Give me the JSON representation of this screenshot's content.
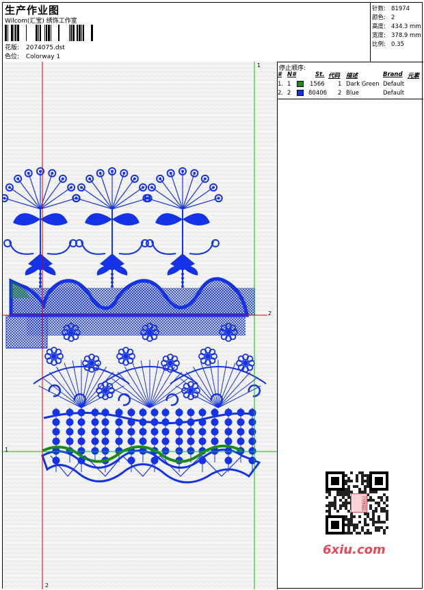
{
  "header": {
    "title": "生产作业图",
    "company": "Wilcom(汇宝) 绣饰工作室",
    "design_label": "花版:",
    "design_value": "2074075.dst",
    "colorway_label": "色位:",
    "colorway_value": "Colorway 1"
  },
  "stats": [
    {
      "label": "针数:",
      "value": "81974"
    },
    {
      "label": "颜色:",
      "value": "2"
    },
    {
      "label": "高度:",
      "value": "434.3 mm"
    },
    {
      "label": "宽度:",
      "value": "378.9 mm"
    },
    {
      "label": "比例:",
      "value": "0.35"
    }
  ],
  "stop_sequence": {
    "title": "停止顺序:",
    "columns": [
      "#",
      "N#",
      "St.",
      "代码",
      "描述",
      "Brand",
      "元素"
    ],
    "rows": [
      {
        "index": "1.",
        "needle": "1",
        "stitches": "1566",
        "code": "1",
        "description": "Dark Green",
        "brand": "Default",
        "color": "#1a8a1a"
      },
      {
        "index": "2.",
        "needle": "2",
        "stitches": "80406",
        "code": "2",
        "description": "Blue",
        "brand": "Default",
        "color": "#1432e6"
      }
    ]
  },
  "guides": {
    "vertical_left": "2",
    "vertical_right": "1",
    "horizontal_top": "2",
    "horizontal_bottom": "1",
    "bottom_label": "2"
  },
  "watermark": {
    "text": "6xiu.com",
    "stamp": "汉语图"
  },
  "colors": {
    "thread_blue": "#1432e6",
    "thread_green": "#1a8a1a",
    "guide_red": "#e00000",
    "guide_green": "#00c000",
    "canvas_bg": "#f3f3f3"
  }
}
